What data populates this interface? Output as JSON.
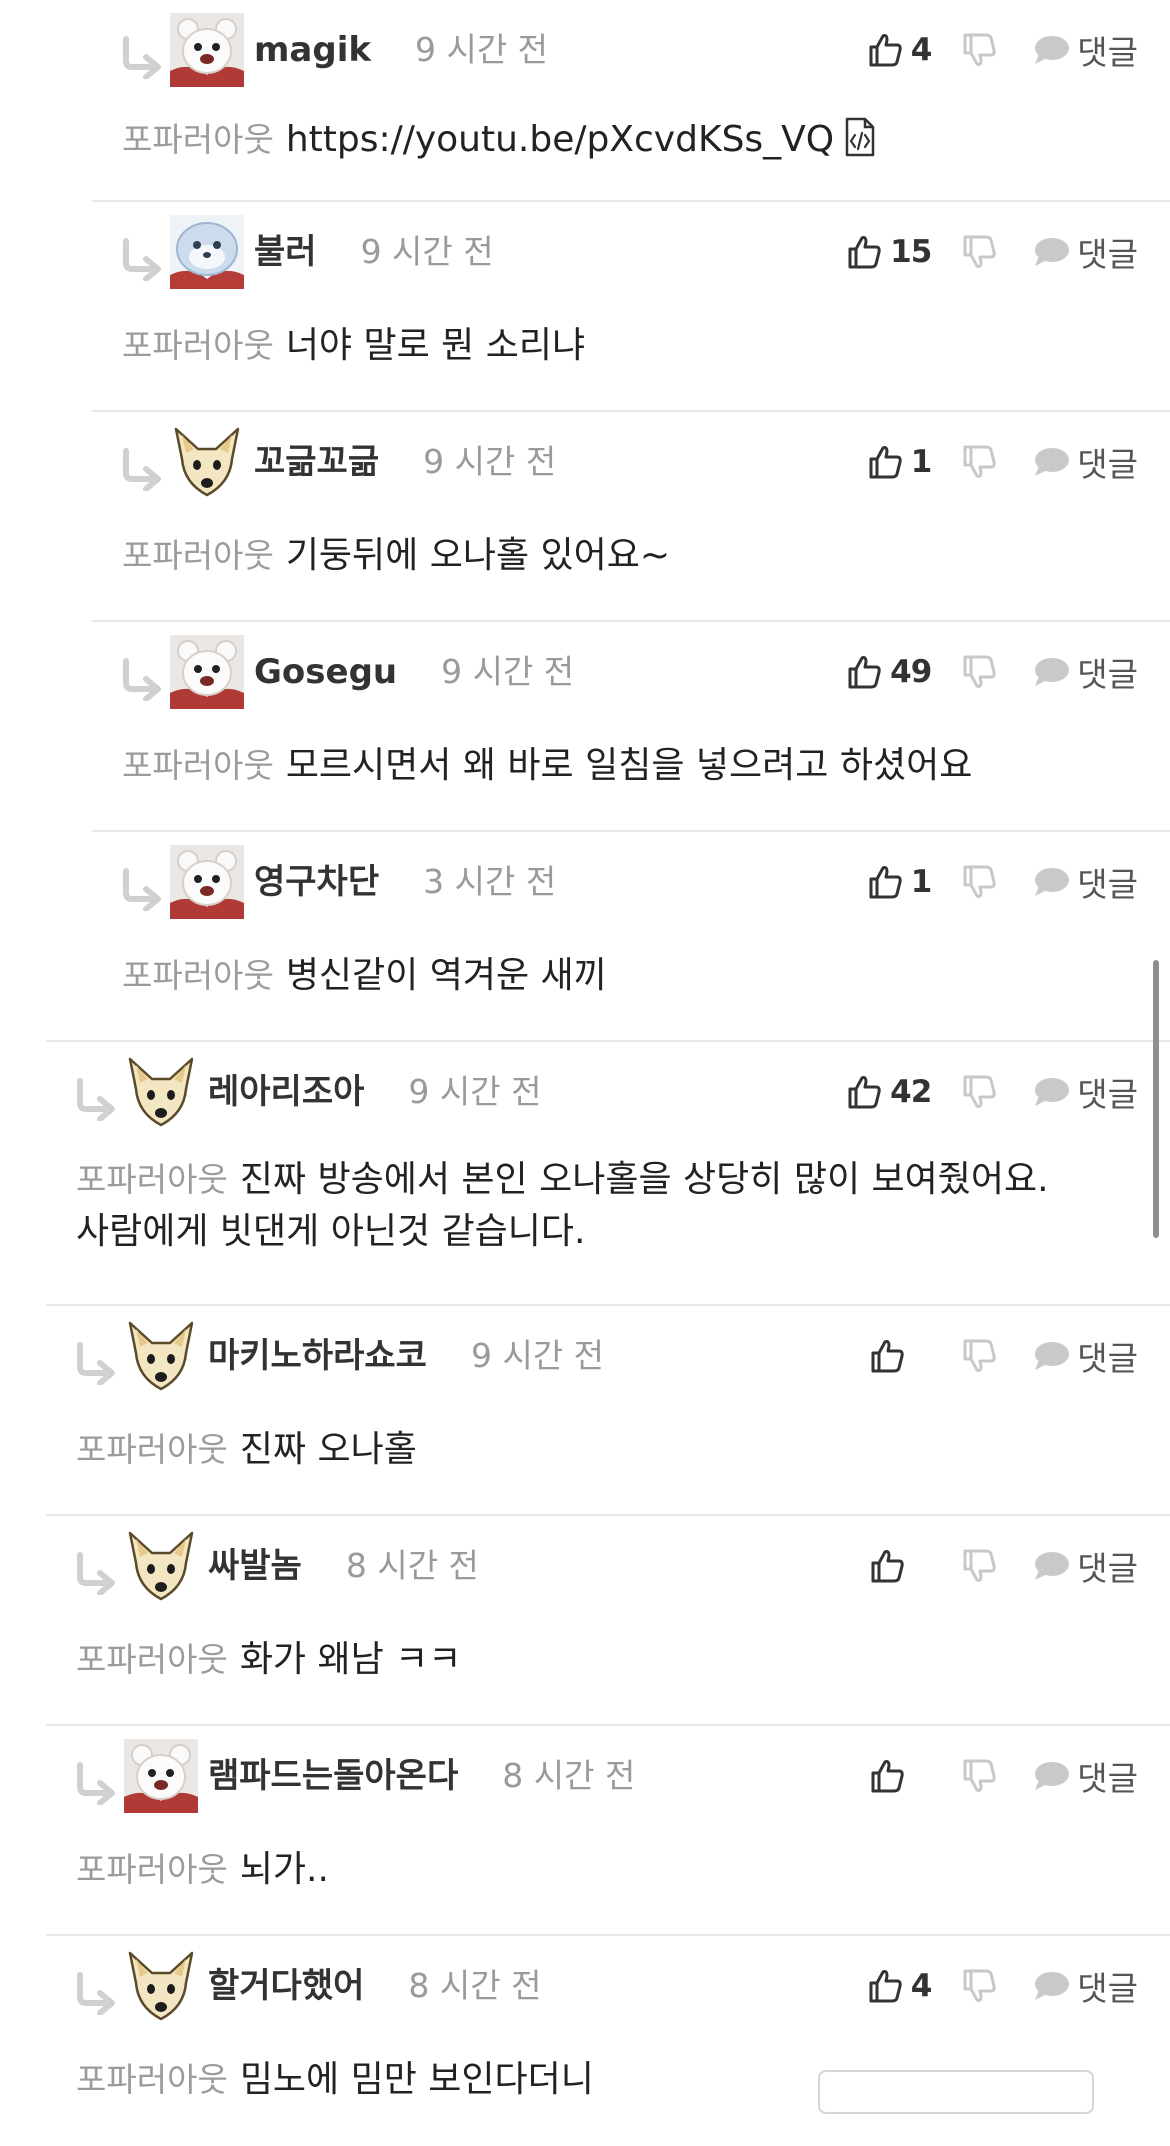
{
  "labels": {
    "writer_badge": "포파러아웃",
    "reply": "댓글"
  },
  "icons": {
    "reply_arrow": "reply-arrow-icon",
    "like": "thumbs-up-icon",
    "dislike": "thumbs-down-icon",
    "comment": "speech-bubble-icon",
    "embed": "embed-code-icon"
  },
  "colors": {
    "writer_badge": "#9b9b9b",
    "time": "#9a9a9a",
    "divider": "#e8e8e8",
    "avatar_bg": "#f3f3f3",
    "reply_arrow": "#d0d0d0"
  },
  "comments": [
    {
      "nick": "magik",
      "time": "9 시간 전",
      "likes": "4",
      "text": "https://youtu.be/pXcvdKSs_VQ",
      "embed": true,
      "avatar": "bear",
      "depth": 2
    },
    {
      "nick": "불러",
      "time": "9 시간 전",
      "likes": "15",
      "text": "너야 말로 뭔 소리냐",
      "avatar": "seal",
      "depth": 2
    },
    {
      "nick": "꼬긂꼬긂",
      "time": "9 시간 전",
      "likes": "1",
      "text": "기둥뒤에 오나홀 있어요~",
      "avatar": "fox",
      "depth": 2
    },
    {
      "nick": "Gosegu",
      "time": "9 시간 전",
      "likes": "49",
      "text": "모르시면서 왜 바로 일침을 넣으려고 하셨어요",
      "avatar": "bear",
      "depth": 2
    },
    {
      "nick": "영구차단",
      "time": "3 시간 전",
      "likes": "1",
      "text": "병신같이 역겨운 새끼",
      "avatar": "bear",
      "depth": 2
    },
    {
      "nick": "레아리조아",
      "time": "9 시간 전",
      "likes": "42",
      "text_line1": "진짜 방송에서 본인 오나홀을 상당히 많이 보여줬어요.",
      "text_line2": "사람에게 빗댄게 아닌것 같습니다.",
      "avatar": "fox",
      "depth": 1
    },
    {
      "nick": "마키노하라쇼코",
      "time": "9 시간 전",
      "likes": "",
      "text": "진짜 오나홀",
      "avatar": "fox",
      "depth": 1
    },
    {
      "nick": "싸발놈",
      "time": "8 시간 전",
      "likes": "",
      "text": "화가 왜남 ㅋㅋ",
      "avatar": "fox",
      "depth": 1
    },
    {
      "nick": "램파드는돌아온다",
      "time": "8 시간 전",
      "likes": "",
      "text": "뇌가..",
      "avatar": "bear",
      "depth": 1
    },
    {
      "nick": "할거다했어",
      "time": "8 시간 전",
      "likes": "4",
      "text": "밈노에 밈만 보인다더니",
      "avatar": "fox",
      "depth": 1
    }
  ]
}
